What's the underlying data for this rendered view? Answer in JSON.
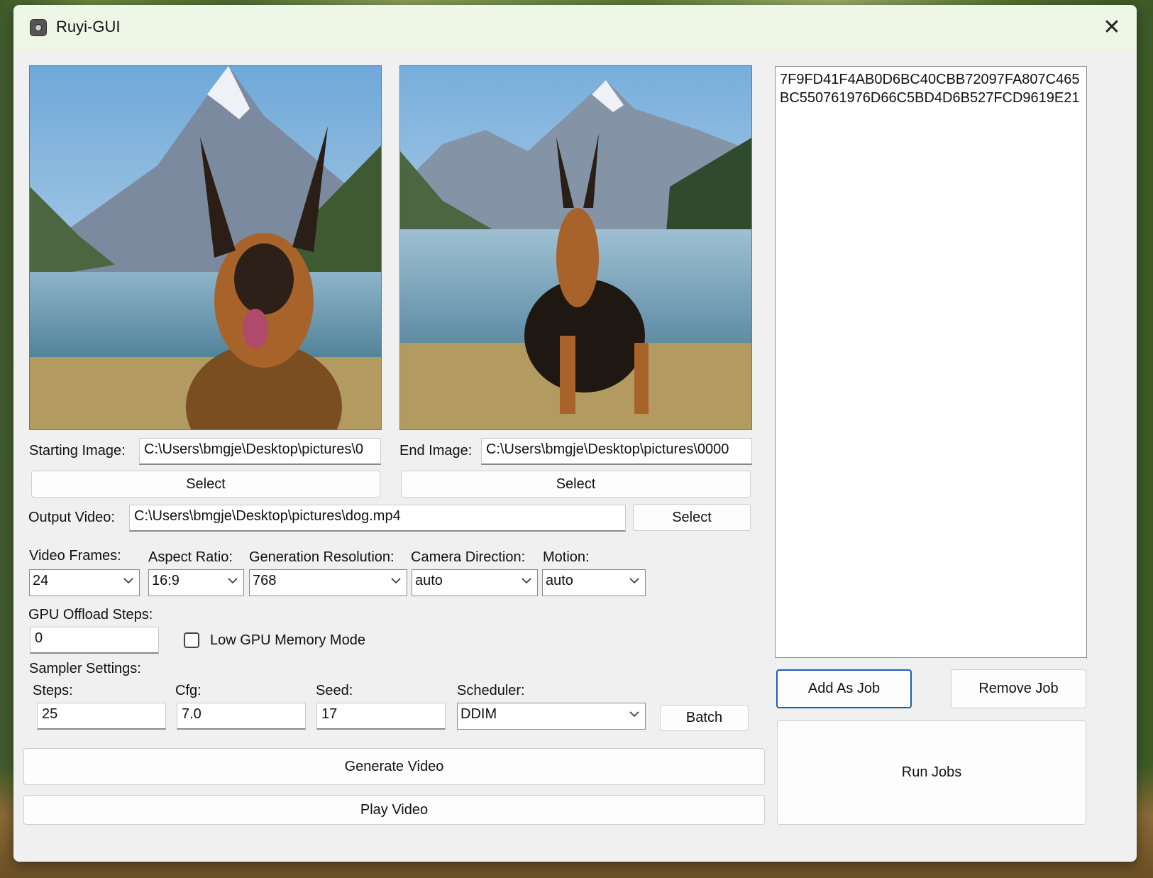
{
  "window": {
    "title": "Ruyi-GUI",
    "close_glyph": "✕"
  },
  "start": {
    "label": "Starting Image:",
    "path": "C:\\Users\\bmgje\\Desktop\\pictures\\0",
    "select_label": "Select"
  },
  "end": {
    "label": "End Image:",
    "path": "C:\\Users\\bmgje\\Desktop\\pictures\\0000",
    "select_label": "Select"
  },
  "output": {
    "label": "Output Video:",
    "path": "C:\\Users\\bmgje\\Desktop\\pictures\\dog.mp4",
    "select_label": "Select"
  },
  "settings": {
    "video_frames": {
      "label": "Video Frames:",
      "value": "24"
    },
    "aspect_ratio": {
      "label": "Aspect Ratio:",
      "value": "16:9"
    },
    "generation_resolution": {
      "label": "Generation Resolution:",
      "value": "768"
    },
    "camera_direction": {
      "label": "Camera Direction:",
      "value": "auto"
    },
    "motion": {
      "label": "Motion:",
      "value": "auto"
    }
  },
  "gpu": {
    "label": "GPU Offload Steps:",
    "value": "0",
    "low_mem_label": "Low GPU Memory Mode",
    "low_mem_checked": false
  },
  "sampler": {
    "label": "Sampler Settings:",
    "steps": {
      "label": "Steps:",
      "value": "25"
    },
    "cfg": {
      "label": "Cfg:",
      "value": "7.0"
    },
    "seed": {
      "label": "Seed:",
      "value": "17"
    },
    "scheduler": {
      "label": "Scheduler:",
      "value": "DDIM"
    },
    "batch_label": "Batch"
  },
  "actions": {
    "generate_label": "Generate Video",
    "play_label": "Play Video"
  },
  "jobs": {
    "items": [
      "7F9FD41F4AB0D6BC40CBB72097FA807C465",
      "BC550761976D66C5BD4D6B527FCD9619E21"
    ],
    "add_label": "Add As Job",
    "remove_label": "Remove Job",
    "run_label": "Run Jobs"
  }
}
